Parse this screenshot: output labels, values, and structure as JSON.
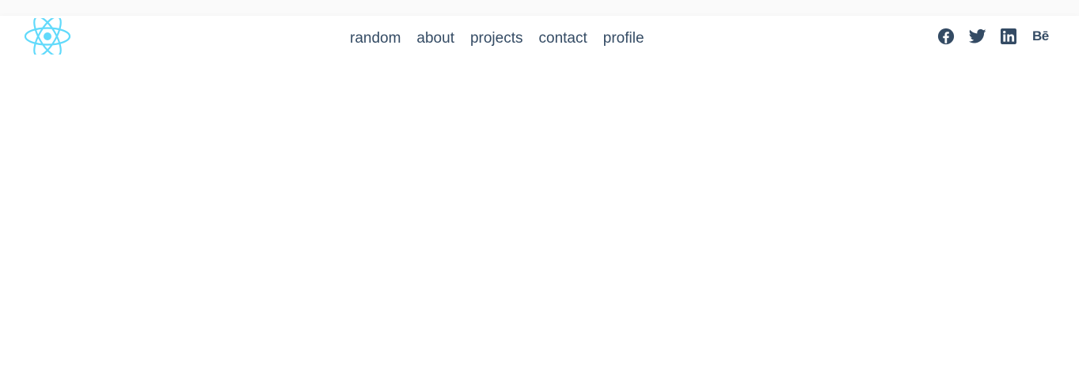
{
  "nav": {
    "links": [
      {
        "label": "random"
      },
      {
        "label": "about"
      },
      {
        "label": "projects"
      },
      {
        "label": "contact"
      },
      {
        "label": "profile"
      }
    ]
  },
  "social": {
    "behance_label": "Bē"
  },
  "icons": {
    "logo": "react-atom-icon",
    "facebook": "facebook-icon",
    "twitter": "twitter-icon",
    "linkedin": "linkedin-icon",
    "behance": "behance-icon"
  },
  "colors": {
    "logo": "#61dafb",
    "nav_text": "#344b64",
    "background": "#ffffff"
  }
}
